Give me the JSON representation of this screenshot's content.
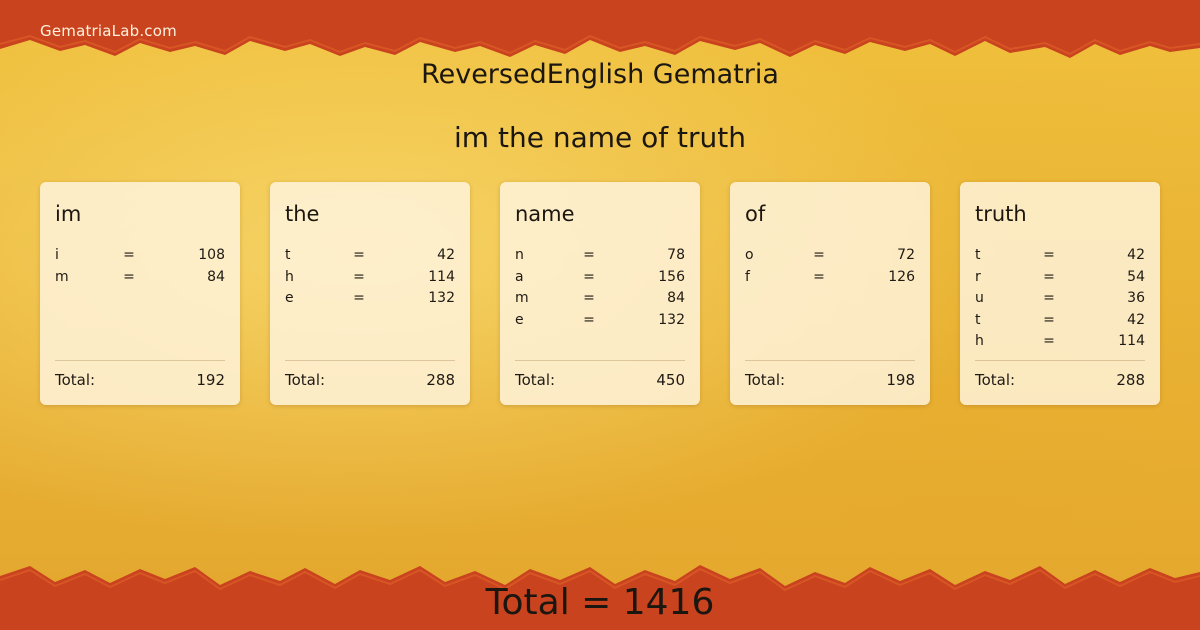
{
  "site": {
    "name": "GematriaLab.com"
  },
  "page": {
    "title": "ReversedEnglish Gematria",
    "phrase": "im the name of truth",
    "grand_total_text": "Total = 1416"
  },
  "theme": {
    "background": "#eab436",
    "border": "#c8431e",
    "card": "#fdf0d8"
  },
  "words": [
    {
      "word": "im",
      "letters": [
        {
          "letter": "i",
          "eq": "=",
          "value": "108"
        },
        {
          "letter": "m",
          "eq": "=",
          "value": "84"
        }
      ],
      "total_label": "Total:",
      "total": "192"
    },
    {
      "word": "the",
      "letters": [
        {
          "letter": "t",
          "eq": "=",
          "value": "42"
        },
        {
          "letter": "h",
          "eq": "=",
          "value": "114"
        },
        {
          "letter": "e",
          "eq": "=",
          "value": "132"
        }
      ],
      "total_label": "Total:",
      "total": "288"
    },
    {
      "word": "name",
      "letters": [
        {
          "letter": "n",
          "eq": "=",
          "value": "78"
        },
        {
          "letter": "a",
          "eq": "=",
          "value": "156"
        },
        {
          "letter": "m",
          "eq": "=",
          "value": "84"
        },
        {
          "letter": "e",
          "eq": "=",
          "value": "132"
        }
      ],
      "total_label": "Total:",
      "total": "450"
    },
    {
      "word": "of",
      "letters": [
        {
          "letter": "o",
          "eq": "=",
          "value": "72"
        },
        {
          "letter": "f",
          "eq": "=",
          "value": "126"
        }
      ],
      "total_label": "Total:",
      "total": "198"
    },
    {
      "word": "truth",
      "letters": [
        {
          "letter": "t",
          "eq": "=",
          "value": "42"
        },
        {
          "letter": "r",
          "eq": "=",
          "value": "54"
        },
        {
          "letter": "u",
          "eq": "=",
          "value": "36"
        },
        {
          "letter": "t",
          "eq": "=",
          "value": "42"
        },
        {
          "letter": "h",
          "eq": "=",
          "value": "114"
        }
      ],
      "total_label": "Total:",
      "total": "288"
    }
  ]
}
